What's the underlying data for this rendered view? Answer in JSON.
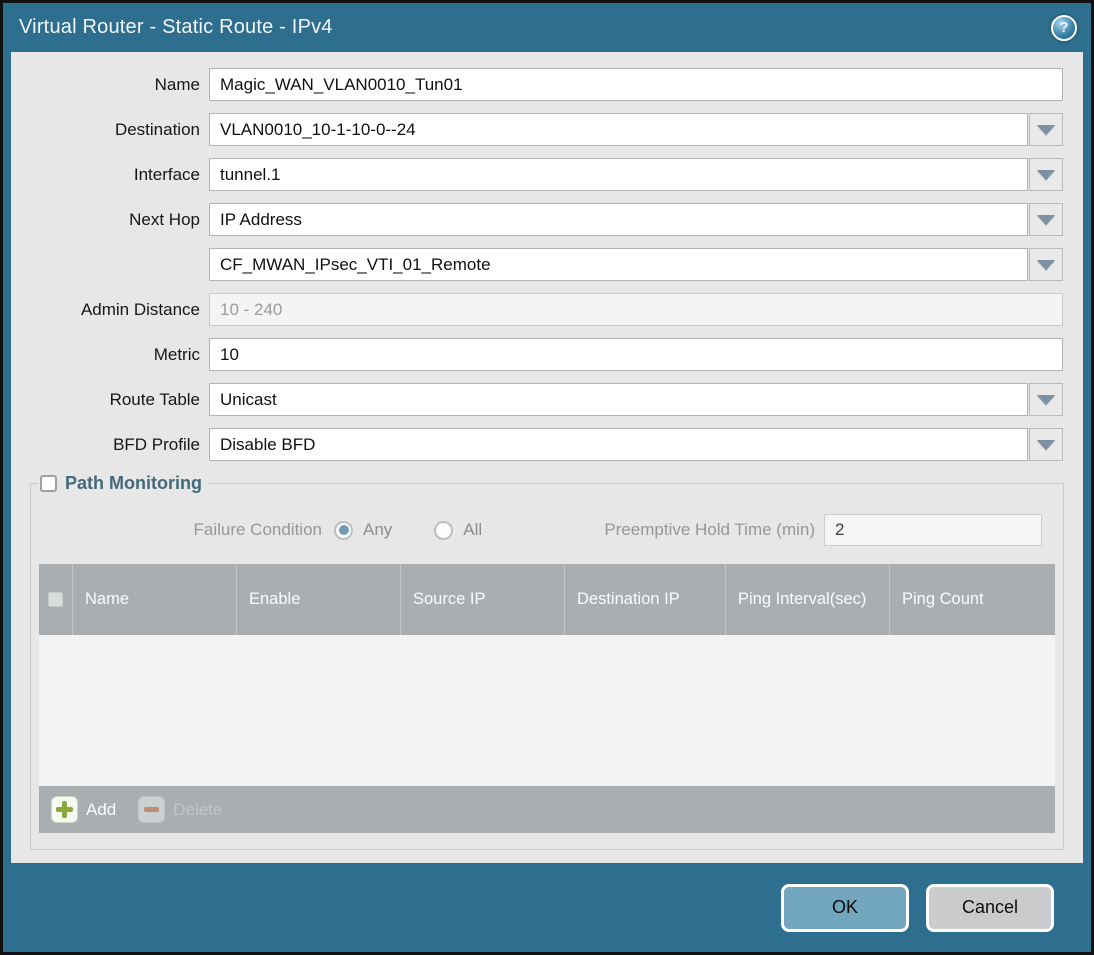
{
  "title_bar": {
    "title": "Virtual Router - Static Route - IPv4",
    "help_glyph": "?"
  },
  "fields": {
    "name": {
      "label": "Name",
      "value": "Magic_WAN_VLAN0010_Tun01"
    },
    "destination": {
      "label": "Destination",
      "value": "VLAN0010_10-1-10-0--24"
    },
    "interface": {
      "label": "Interface",
      "value": "tunnel.1"
    },
    "next_hop": {
      "label": "Next Hop",
      "value": "IP Address"
    },
    "next_hop_address": {
      "value": "CF_MWAN_IPsec_VTI_01_Remote"
    },
    "admin_distance": {
      "label": "Admin Distance",
      "placeholder": "10 - 240",
      "value": ""
    },
    "metric": {
      "label": "Metric",
      "value": "10"
    },
    "route_table": {
      "label": "Route Table",
      "value": "Unicast"
    },
    "bfd_profile": {
      "label": "BFD Profile",
      "value": "Disable BFD"
    }
  },
  "path_monitoring": {
    "title": "Path Monitoring",
    "checked": false,
    "failure_condition": {
      "label": "Failure Condition",
      "options": [
        {
          "label": "Any",
          "selected": true
        },
        {
          "label": "All",
          "selected": false
        }
      ]
    },
    "preemptive_hold_time": {
      "label": "Preemptive Hold Time (min)",
      "value": "2"
    },
    "table": {
      "columns": [
        "Name",
        "Enable",
        "Source IP",
        "Destination IP",
        "Ping Interval(sec)",
        "Ping Count"
      ],
      "rows": []
    },
    "toolbar": {
      "add_label": "Add",
      "delete_label": "Delete"
    }
  },
  "footer": {
    "ok_label": "OK",
    "cancel_label": "Cancel"
  },
  "colors": {
    "frame_teal": "#2e6e8e",
    "body_gray": "#e7e7e8",
    "table_header_gray": "#aaaeb0",
    "ok_button_blue": "#73a6bf",
    "cancel_button_gray": "#c9cbcd",
    "radio_selected_blue": "#6f9cb2",
    "add_icon_green": "#8aa73e",
    "delete_icon_red": "#bd8d7b"
  }
}
